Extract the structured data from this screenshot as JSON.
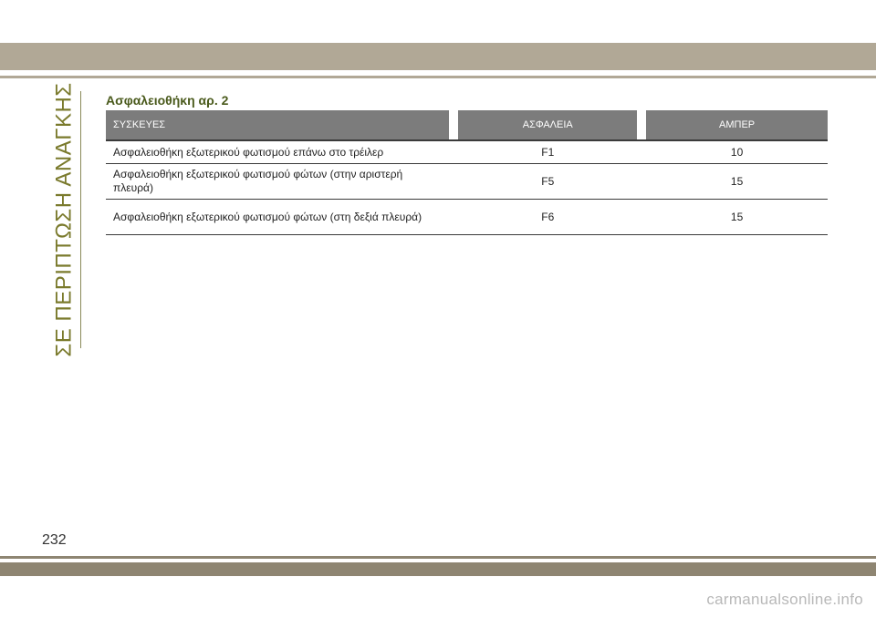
{
  "side_title": "ΣΕ ΠΕΡΙΠΤΩΣΗ ΑΝΑΓΚΗΣ",
  "section_title": "Ασφαλειοθήκη αρ. 2",
  "table": {
    "headers": {
      "device": "ΣΥΣΚΕΥΕΣ",
      "fuse": "ΑΣΦΑΛΕΙΑ",
      "amp": "ΑΜΠΕΡ"
    },
    "rows": [
      {
        "device": "Ασφαλειοθήκη εξωτερικού φωτισμού επάνω στο τρέιλερ",
        "fuse": "F1",
        "amp": "10"
      },
      {
        "device": "Ασφαλειοθήκη εξωτερικού φωτισμού φώτων (στην αριστερή πλευρά)",
        "fuse": "F5",
        "amp": "15"
      },
      {
        "device": "Ασφαλειοθήκη εξωτερικού φωτισμού φώτων (στη δεξιά πλευρά)",
        "fuse": "F6",
        "amp": "15"
      }
    ]
  },
  "page_number": "232",
  "watermark": "carmanualsonline.info",
  "colors": {
    "band": "#b1a896",
    "band_dark": "#8e8572",
    "header_bg": "#7c7c7c",
    "accent_text": "#7a7a2c",
    "title_text": "#4a5a1c"
  }
}
